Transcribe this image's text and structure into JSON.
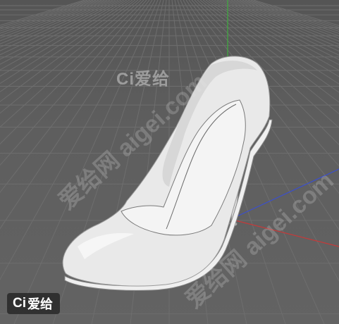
{
  "viewport": {
    "background_color": "#5e5e5e",
    "grid_color": "#6e6e6e",
    "axis_colors": {
      "x": "#c43a3a",
      "y": "#3fae3f",
      "z": "#3a4fd0"
    },
    "object": "high-heel-shoe"
  },
  "watermarks": {
    "logo_text": "Ci爱给",
    "site_url": "aigei.com",
    "site_name": "爱给网",
    "diag_line_1": "爱给网 aigei.com",
    "diag_line_2": "爱给网 aigei.com"
  },
  "badge": {
    "mark": "Ci",
    "label": "爱给"
  }
}
